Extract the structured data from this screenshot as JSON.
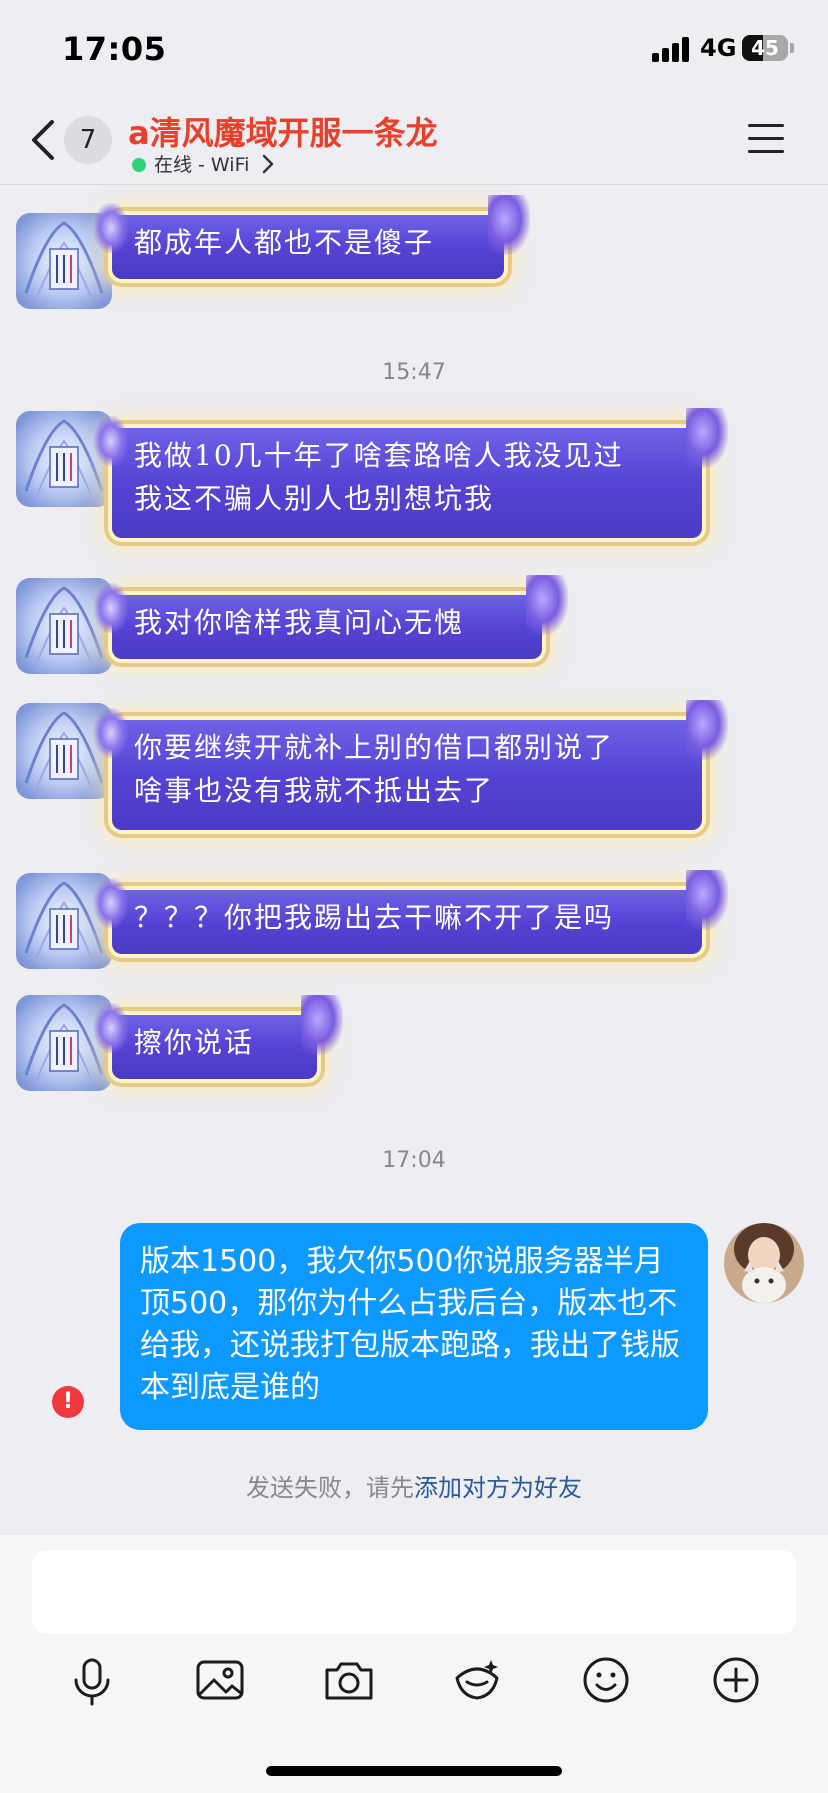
{
  "status_bar": {
    "time": "17:05",
    "network": "4G",
    "battery": "45",
    "battery_level": 0.45
  },
  "nav": {
    "unread_count": "7",
    "title": "a清风魔域开服一条龙",
    "presence": "在线 - WiFi"
  },
  "messages": [
    {
      "type": "incoming",
      "lines": [
        "都成年人都也不是傻子"
      ]
    },
    {
      "type": "time",
      "text": "15:47"
    },
    {
      "type": "incoming",
      "lines": [
        "我做10几十年了啥套路啥人我没见过",
        "我这不骗人别人也别想坑我"
      ]
    },
    {
      "type": "incoming",
      "lines": [
        "我对你啥样我真问心无愧"
      ]
    },
    {
      "type": "incoming",
      "lines": [
        "你要继续开就补上别的借口都别说了",
        "啥事也没有我就不抵出去了"
      ]
    },
    {
      "type": "incoming",
      "lines": [
        "？？？你把我踢出去干嘛不开了是吗"
      ]
    },
    {
      "type": "incoming",
      "lines": [
        "擦你说话"
      ]
    },
    {
      "type": "time",
      "text": "17:04"
    },
    {
      "type": "outgoing",
      "text": "版本1500，我欠你500你说服务器半月顶500，那你为什么占我后台，版本也不给我，还说我打包版本跑路，我出了钱版本到底是谁的"
    }
  ],
  "notice": {
    "prefix": "发送失败，请先",
    "link": "添加对方为好友"
  },
  "toolbar": [
    "microphone-icon",
    "image-icon",
    "camera-icon",
    "sticker-icon",
    "emoji-icon",
    "plus-icon"
  ]
}
